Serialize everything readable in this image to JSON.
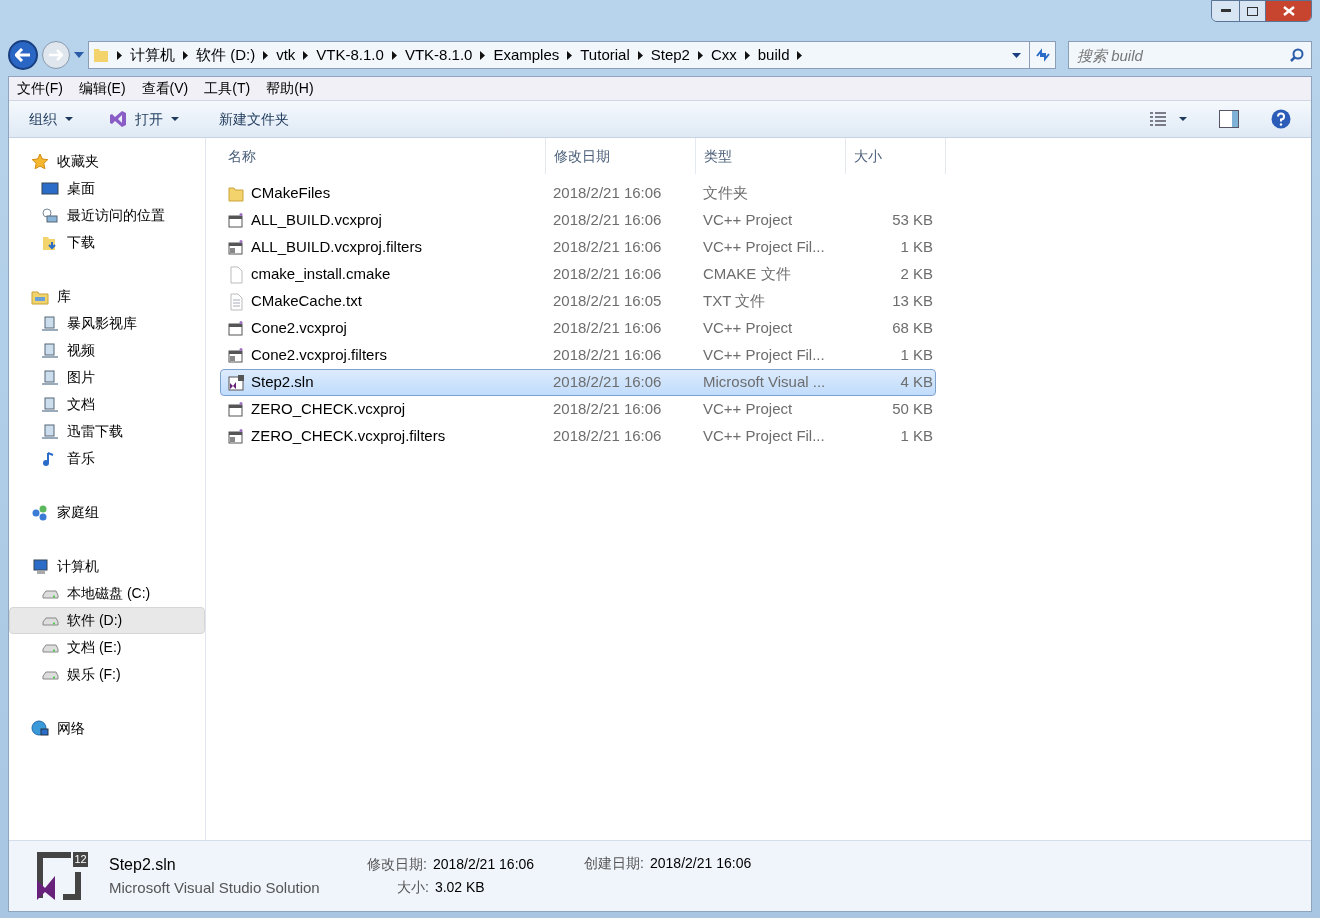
{
  "breadcrumb": [
    "计算机",
    "软件 (D:)",
    "vtk",
    "VTK-8.1.0",
    "VTK-8.1.0",
    "Examples",
    "Tutorial",
    "Step2",
    "Cxx",
    "build"
  ],
  "search": {
    "placeholder": "搜索 build"
  },
  "menu": [
    "文件(F)",
    "编辑(E)",
    "查看(V)",
    "工具(T)",
    "帮助(H)"
  ],
  "toolbar": {
    "organize": "组织",
    "open": "打开",
    "new_folder": "新建文件夹"
  },
  "sidebar": [
    {
      "label": "收藏夹",
      "kind": "star",
      "children": [
        {
          "label": "桌面",
          "kind": "desktop",
          "selected": false
        },
        {
          "label": "最近访问的位置",
          "kind": "recent",
          "selected": false
        },
        {
          "label": "下载",
          "kind": "download",
          "selected": false
        }
      ]
    },
    {
      "label": "库",
      "kind": "library",
      "children": [
        {
          "label": "暴风影视库",
          "kind": "lib",
          "selected": false
        },
        {
          "label": "视频",
          "kind": "lib",
          "selected": false
        },
        {
          "label": "图片",
          "kind": "lib",
          "selected": false
        },
        {
          "label": "文档",
          "kind": "lib",
          "selected": false
        },
        {
          "label": "迅雷下载",
          "kind": "lib",
          "selected": false
        },
        {
          "label": "音乐",
          "kind": "music",
          "selected": false
        }
      ]
    },
    {
      "label": "家庭组",
      "kind": "homegroup"
    },
    {
      "label": "计算机",
      "kind": "computer",
      "children": [
        {
          "label": "本地磁盘 (C:)",
          "kind": "drive",
          "selected": false
        },
        {
          "label": "软件 (D:)",
          "kind": "drive",
          "selected": true
        },
        {
          "label": "文档 (E:)",
          "kind": "drive",
          "selected": false
        },
        {
          "label": "娱乐 (F:)",
          "kind": "drive",
          "selected": false
        }
      ]
    },
    {
      "label": "网络",
      "kind": "network"
    }
  ],
  "table": {
    "columns": [
      "名称",
      "修改日期",
      "类型",
      "大小"
    ],
    "rows": [
      {
        "name": "CMakeFiles",
        "date": "2018/2/21 16:06",
        "type": "文件夹",
        "kind": "folder",
        "selected": false
      },
      {
        "name": "ALL_BUILD.vcxproj",
        "date": "2018/2/21 16:06",
        "type": "VC++ Project",
        "size": "53 KB",
        "kind": "project",
        "selected": false
      },
      {
        "name": "ALL_BUILD.vcxproj.filters",
        "date": "2018/2/21 16:06",
        "type": "VC++ Project Fil...",
        "size": "1 KB",
        "kind": "filters",
        "selected": false
      },
      {
        "name": "cmake_install.cmake",
        "date": "2018/2/21 16:06",
        "type": "CMAKE 文件",
        "size": "2 KB",
        "kind": "blank",
        "selected": false
      },
      {
        "name": "CMakeCache.txt",
        "date": "2018/2/21 16:05",
        "type": "TXT 文件",
        "size": "13 KB",
        "kind": "text",
        "selected": false
      },
      {
        "name": "Cone2.vcxproj",
        "date": "2018/2/21 16:06",
        "type": "VC++ Project",
        "size": "68 KB",
        "kind": "project",
        "selected": false
      },
      {
        "name": "Cone2.vcxproj.filters",
        "date": "2018/2/21 16:06",
        "type": "VC++ Project Fil...",
        "size": "1 KB",
        "kind": "filters",
        "selected": false
      },
      {
        "name": "Step2.sln",
        "date": "2018/2/21 16:06",
        "type": "Microsoft Visual ...",
        "size": "4 KB",
        "kind": "solution",
        "selected": true
      },
      {
        "name": "ZERO_CHECK.vcxproj",
        "date": "2018/2/21 16:06",
        "type": "VC++ Project",
        "size": "50 KB",
        "kind": "project",
        "selected": false
      },
      {
        "name": "ZERO_CHECK.vcxproj.filters",
        "date": "2018/2/21 16:06",
        "type": "VC++ Project Fil...",
        "size": "1 KB",
        "kind": "filters",
        "selected": false
      }
    ]
  },
  "details": {
    "name": "Step2.sln",
    "type": "Microsoft Visual Studio Solution",
    "badge": "12",
    "modified_label": "修改日期:",
    "modified": "2018/2/21 16:06",
    "created_label": "创建日期:",
    "created": "2018/2/21 16:06",
    "size_label": "大小:",
    "size": "3.02 KB"
  }
}
